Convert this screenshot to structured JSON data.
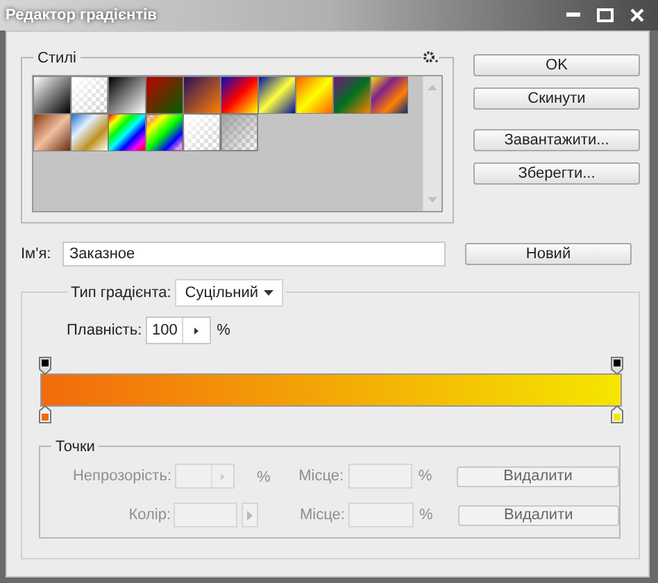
{
  "window": {
    "title": "Редактор градієнтів"
  },
  "presets": {
    "title": "Стилі"
  },
  "buttons": [
    {
      "label": "OK"
    },
    {
      "label": "Скинути"
    },
    {
      "label": "Завантажити..."
    },
    {
      "label": "Зберегти..."
    }
  ],
  "name": {
    "label": "Ім'я:",
    "value": "Заказное",
    "button": "Новий"
  },
  "gradient": {
    "type_label": "Тип градієнта:",
    "type_value": "Суцільний",
    "smoothness_label": "Плавність:",
    "smoothness_value": "100",
    "smoothness_unit": "%",
    "opacity_stops": [
      {
        "color": "#000000"
      },
      {
        "color": "#000000"
      }
    ],
    "color_stops": [
      {
        "color": "#f26a0c"
      },
      {
        "color": "#f5e600"
      }
    ]
  },
  "stops": {
    "title": "Точки",
    "rows": [
      {
        "label": "Непрозорість:",
        "unit": "%",
        "kind": "stepper",
        "location_label": "Місце:",
        "location_unit": "%",
        "button": "Видалити",
        "disabled": true
      },
      {
        "label": "Колір:",
        "kind": "swatch",
        "location_label": "Місце:",
        "location_unit": "%",
        "button": "Видалити",
        "disabled": true
      }
    ]
  }
}
